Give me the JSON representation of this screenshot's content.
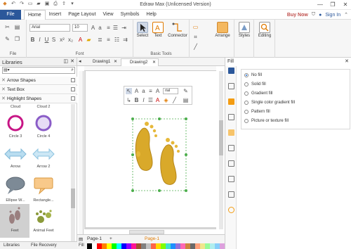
{
  "window": {
    "title": "Edraw Max (Unlicensed Version)",
    "controls": [
      "—",
      "❐",
      "✕"
    ]
  },
  "menu": {
    "file": "File",
    "tabs": [
      "Home",
      "Insert",
      "Page Layout",
      "View",
      "Symbols",
      "Help"
    ],
    "buy_now": "Buy Now",
    "sign_in": "Sign In"
  },
  "ribbon": {
    "font_name": "Arial",
    "font_size": "10",
    "groups": {
      "file": "File",
      "font": "Font",
      "basic_tools": "Basic Tools"
    },
    "buttons": {
      "select": "Select",
      "text": "Text",
      "connector": "Connector",
      "arrange": "Arrange",
      "styles": "Styles",
      "editing": "Editing"
    }
  },
  "libraries": {
    "title": "Libraries",
    "categories": [
      "Arrow Shapes",
      "Text Box",
      "Highlight Shapes"
    ],
    "shapes": [
      {
        "label": "Cloud"
      },
      {
        "label": "Cloud 2"
      },
      {
        "label": "Circle 3"
      },
      {
        "label": "Circle 4"
      },
      {
        "label": "Arrow"
      },
      {
        "label": "Arrow 2"
      },
      {
        "label": "Ellipse W..."
      },
      {
        "label": "Rectangle..."
      },
      {
        "label": "Feet"
      },
      {
        "label": "Animal Feet"
      }
    ],
    "tabs": [
      "Libraries",
      "File Recovery"
    ]
  },
  "documents": {
    "tabs": [
      "Drawing1",
      "Drawing2"
    ],
    "active_tab": "Drawing2",
    "page_tab": "Page-1",
    "page_tab_active": "Page-1",
    "fill_label": "Fill"
  },
  "mini_toolbar": {
    "font_name": "rial"
  },
  "fill_panel": {
    "title": "Fill",
    "options": [
      {
        "label": "No fill",
        "selected": true
      },
      {
        "label": "Solid fill",
        "selected": false
      },
      {
        "label": "Gradient fill",
        "selected": false
      },
      {
        "label": "Single color gradient fill",
        "selected": false
      },
      {
        "label": "Pattern fill",
        "selected": false
      },
      {
        "label": "Picture or texture fill",
        "selected": false
      }
    ]
  },
  "colors": {
    "file_tab": "#2b579a",
    "accent_orange": "#f39c12",
    "footprint_gold": "#d9a92a",
    "palette": [
      "#000000",
      "#ffffff",
      "#ff0000",
      "#ff7f00",
      "#ffff00",
      "#00ff00",
      "#00ffff",
      "#0000ff",
      "#8b00ff",
      "#ff1493",
      "#a0522d",
      "#808080",
      "#c0c0c0",
      "#ff6347",
      "#ffd700",
      "#7fff00",
      "#40e0d0",
      "#1e90ff",
      "#9370db",
      "#ff69b4",
      "#cd853f",
      "#696969",
      "#ffa07a",
      "#f0e68c",
      "#98fb98",
      "#afeeee",
      "#87cefa",
      "#dda0dd"
    ]
  }
}
